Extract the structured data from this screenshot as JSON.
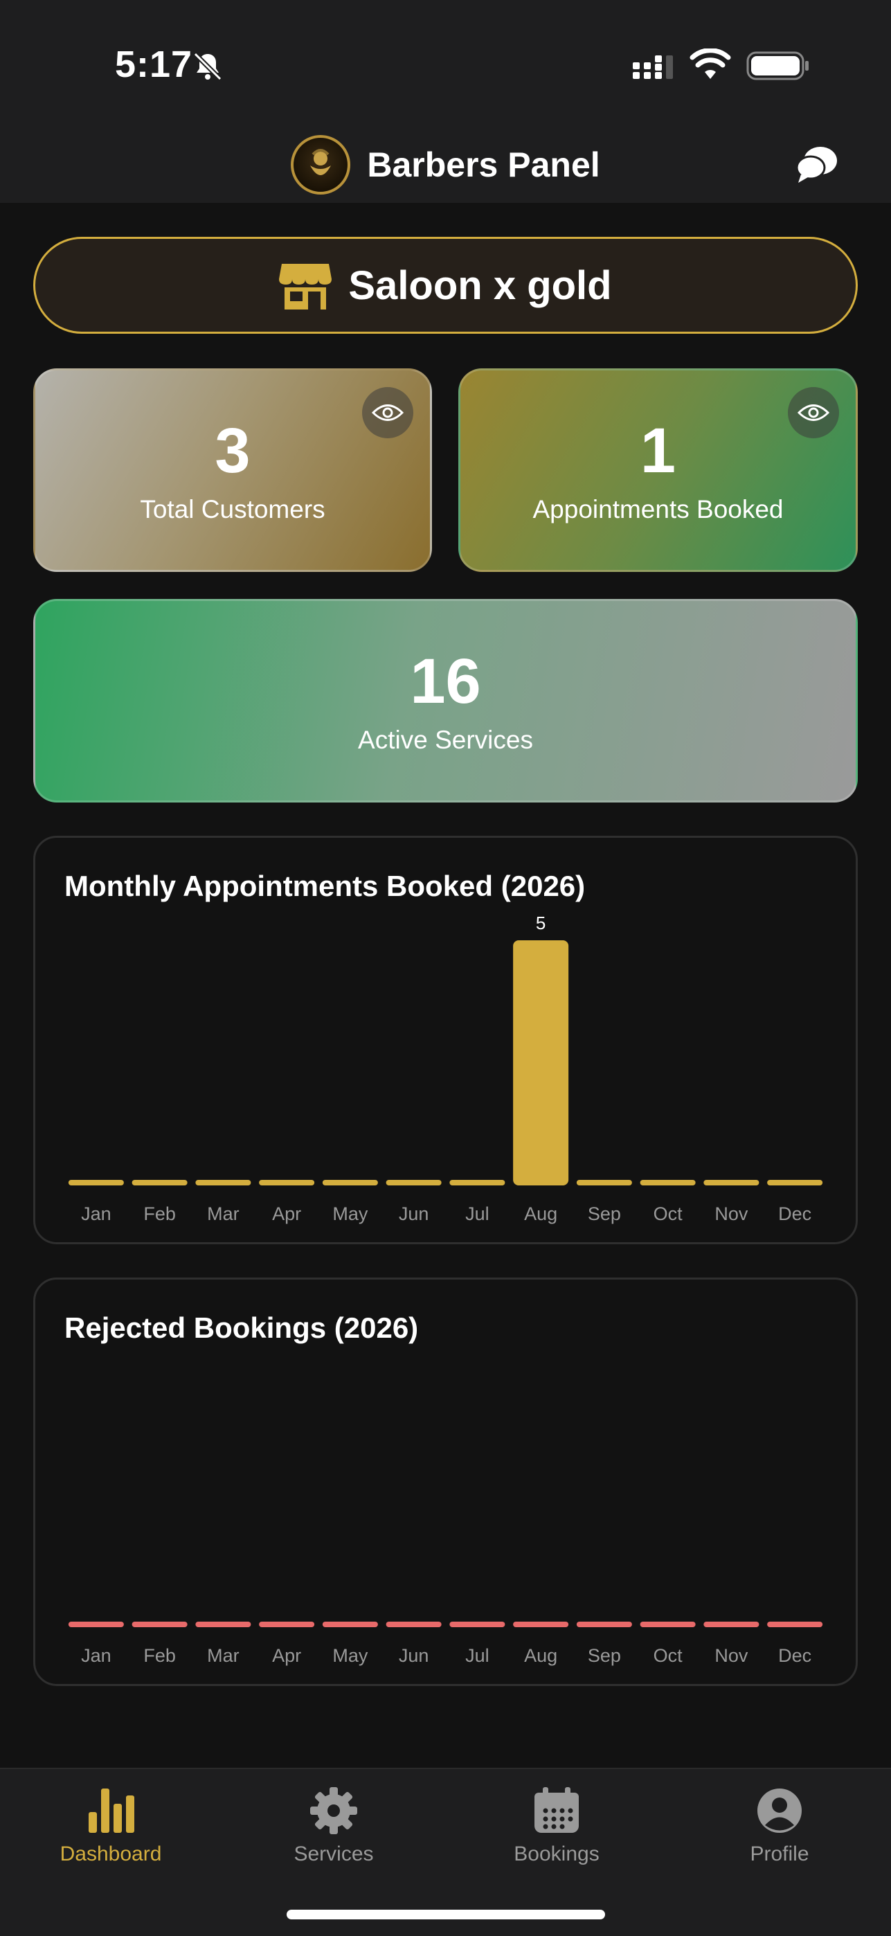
{
  "status": {
    "time": "5:17"
  },
  "header": {
    "title": "Barbers Panel"
  },
  "salon": {
    "name": "Saloon x gold"
  },
  "stats": [
    {
      "value": "3",
      "label": "Total Customers"
    },
    {
      "value": "1",
      "label": "Appointments Booked"
    },
    {
      "value": "16",
      "label": "Active Services"
    }
  ],
  "colors": {
    "accent": "#d4ae3e",
    "rejected": "#e86a6a",
    "tab_inactive": "#9a9a9a"
  },
  "chart_data": [
    {
      "type": "bar",
      "title": "Monthly Appointments Booked (2026)",
      "categories": [
        "Jan",
        "Feb",
        "Mar",
        "Apr",
        "May",
        "Jun",
        "Jul",
        "Aug",
        "Sep",
        "Oct",
        "Nov",
        "Dec"
      ],
      "values": [
        0,
        0,
        0,
        0,
        0,
        0,
        0,
        5,
        0,
        0,
        0,
        0
      ],
      "data_labels": [
        "",
        "",
        "",
        "",
        "",
        "",
        "",
        "5",
        "",
        "",
        "",
        ""
      ],
      "ylim": [
        0,
        5
      ],
      "color": "#d4ae3e"
    },
    {
      "type": "bar",
      "title": "Rejected Bookings (2026)",
      "categories": [
        "Jan",
        "Feb",
        "Mar",
        "Apr",
        "May",
        "Jun",
        "Jul",
        "Aug",
        "Sep",
        "Oct",
        "Nov",
        "Dec"
      ],
      "values": [
        0,
        0,
        0,
        0,
        0,
        0,
        0,
        0,
        0,
        0,
        0,
        0
      ],
      "data_labels": [
        "",
        "",
        "",
        "",
        "",
        "",
        "",
        "",
        "",
        "",
        "",
        ""
      ],
      "ylim": [
        0,
        5
      ],
      "color": "#e86a6a"
    }
  ],
  "tabs": [
    {
      "label": "Dashboard",
      "icon": "bar-chart-icon",
      "active": true
    },
    {
      "label": "Services",
      "icon": "gear-icon",
      "active": false
    },
    {
      "label": "Bookings",
      "icon": "calendar-icon",
      "active": false
    },
    {
      "label": "Profile",
      "icon": "user-circle-icon",
      "active": false
    }
  ]
}
